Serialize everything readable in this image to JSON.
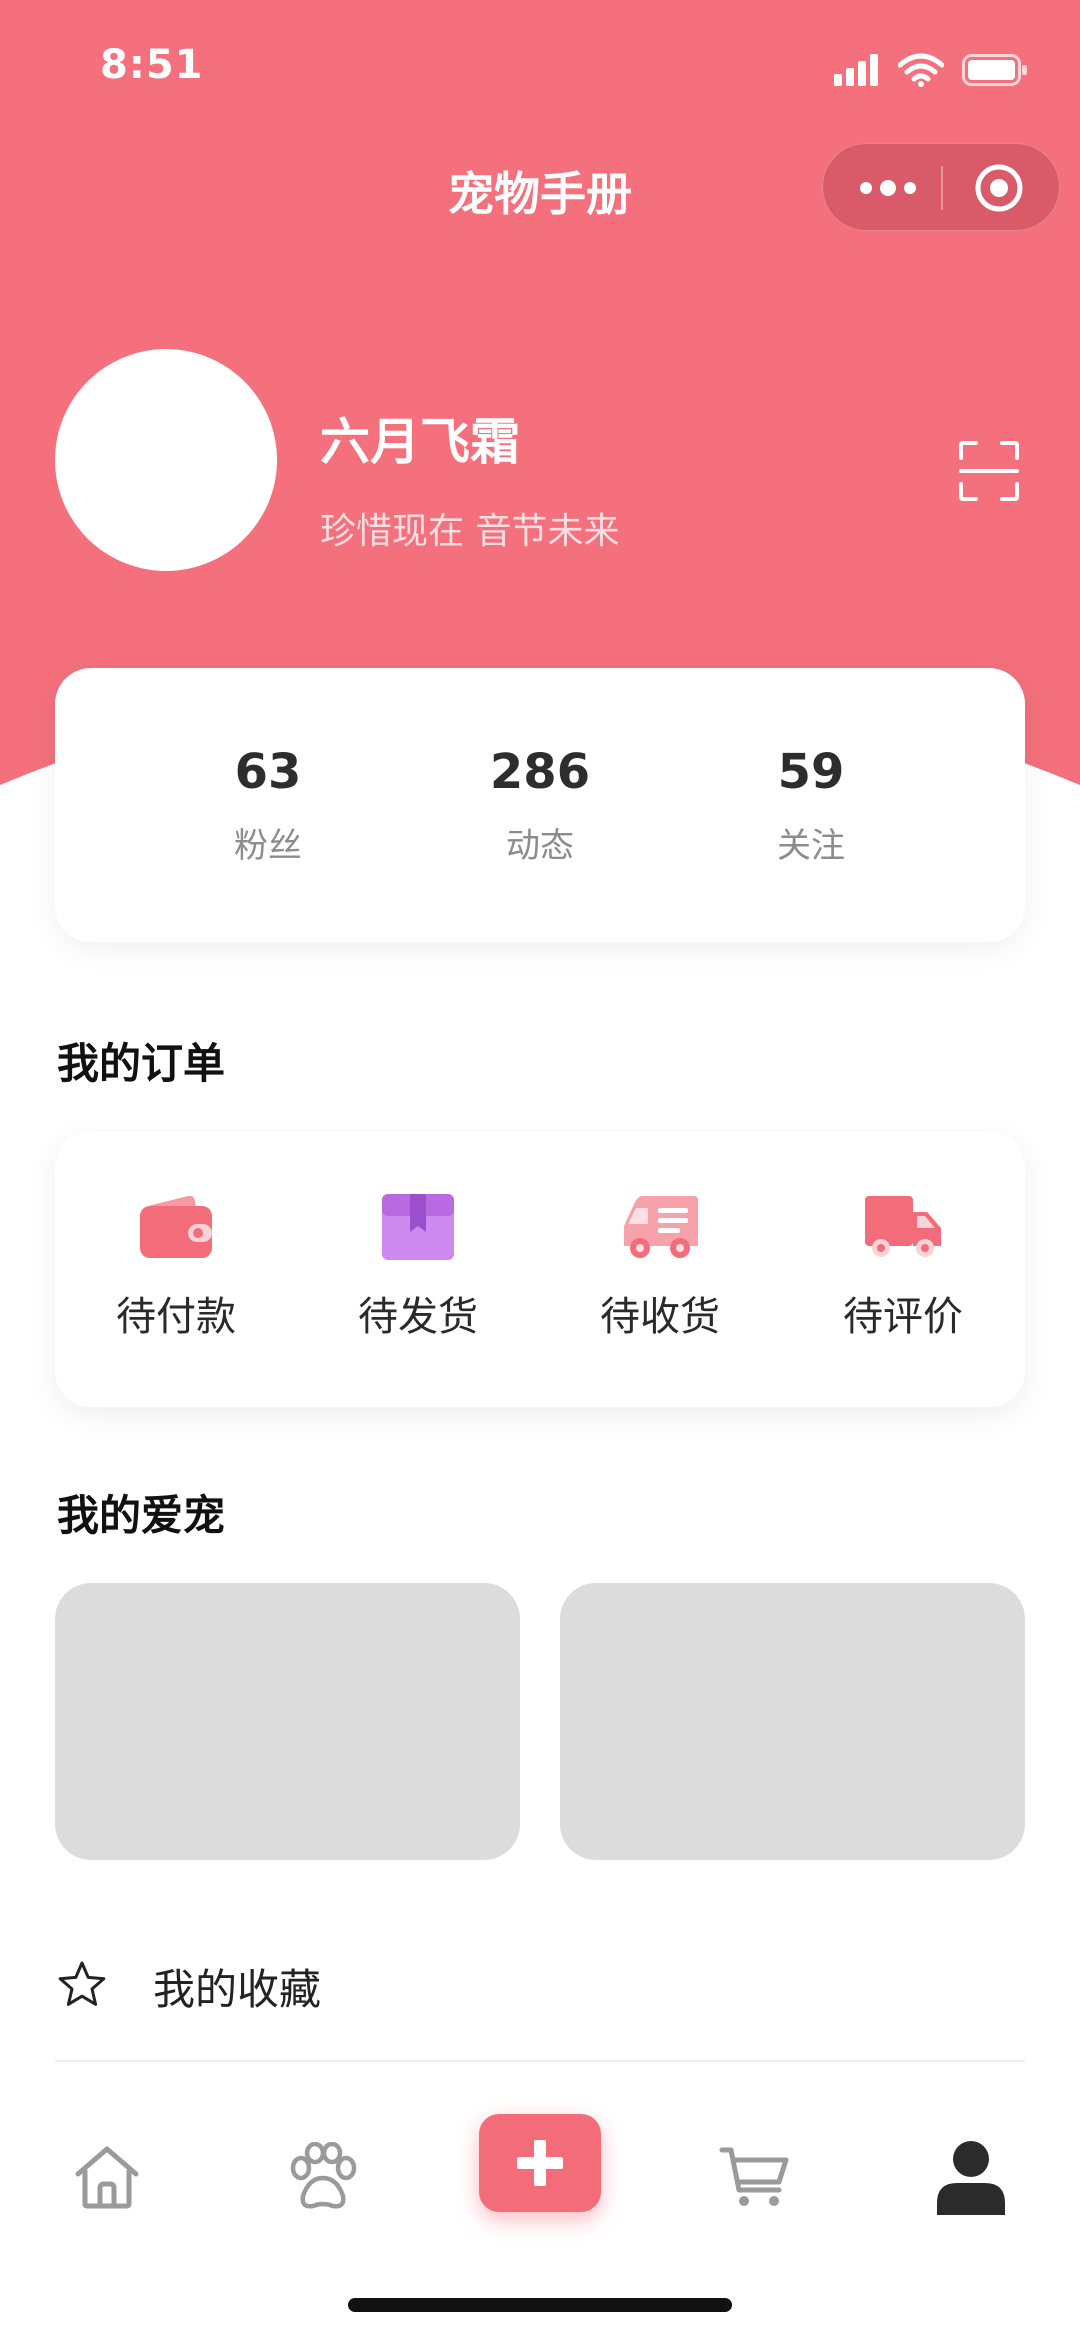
{
  "status_bar": {
    "time": "8:51"
  },
  "nav": {
    "title": "宠物手册"
  },
  "profile": {
    "name": "六月飞霜",
    "motto": "珍惜现在 音节未来"
  },
  "stats": [
    {
      "value": "63",
      "label": "粉丝"
    },
    {
      "value": "286",
      "label": "动态"
    },
    {
      "value": "59",
      "label": "关注"
    }
  ],
  "orders": {
    "title": "我的订单",
    "items": [
      {
        "label": "待付款",
        "icon": "wallet-icon",
        "color": "#f26d79"
      },
      {
        "label": "待发货",
        "icon": "package-icon",
        "color": "#c77be6"
      },
      {
        "label": "待收货",
        "icon": "van-icon",
        "color": "#f48a95"
      },
      {
        "label": "待评价",
        "icon": "truck-icon",
        "color": "#f26d79"
      }
    ]
  },
  "pets": {
    "title": "我的爱宠"
  },
  "favorites": {
    "label": "我的收藏",
    "icon": "star-outline-icon"
  },
  "tabbar": {
    "items": [
      "home-icon",
      "paw-icon",
      "add-icon",
      "cart-icon",
      "user-icon"
    ],
    "active": "user-icon"
  },
  "colors": {
    "brand": "#f26d79",
    "header": "#f3707c",
    "placeholder": "#dcdcdc"
  }
}
